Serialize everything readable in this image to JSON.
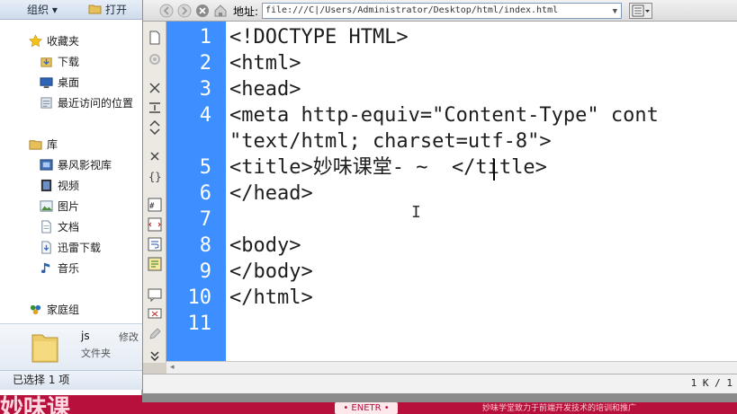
{
  "explorer": {
    "toolbar": {
      "organize": "组织 ▾",
      "open": "打开"
    },
    "nav": {
      "favorites": "收藏夹",
      "favorites_items": [
        "下载",
        "桌面",
        "最近访问的位置"
      ],
      "library": "库",
      "library_items": [
        "暴风影视库",
        "视频",
        "图片",
        "文档",
        "迅雷下载",
        "音乐"
      ],
      "homegroup": "家庭组"
    },
    "details": {
      "name": "js",
      "type": "文件夹",
      "modified": "修改"
    },
    "status": "已选择 1 项"
  },
  "editor": {
    "address_label": "地址:",
    "address_value": "file:///C|/Users/Administrator/Desktop/html/index.html",
    "line_numbers": [
      "1",
      "2",
      "3",
      "4",
      "",
      "5",
      "6",
      "7",
      "8",
      "9",
      "10",
      "11"
    ],
    "code_lines": [
      "<!DOCTYPE HTML>",
      "<html>",
      "<head>",
      "<meta http-equiv=\"Content-Type\" cont",
      "\"text/html; charset=utf-8\">",
      "<title>妙味课堂- ~  </title>",
      "</head>",
      "",
      "<body>",
      "</body>",
      "</html>",
      ""
    ],
    "scroll_indicator": "◂",
    "size_info": "1 K / 1"
  },
  "background": {
    "banner_text": "妙味课",
    "badge": "• ENETR •",
    "tagline": "妙味学堂致力于前端开发技术的培训和推广"
  },
  "colors": {
    "gutter": "#3d8fff",
    "desktop": "#b8103c"
  }
}
